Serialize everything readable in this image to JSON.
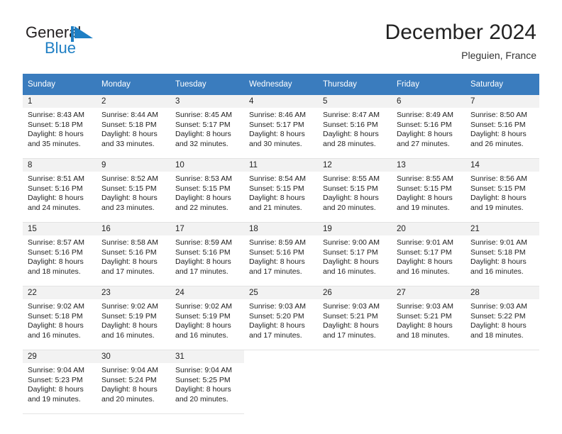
{
  "brand": {
    "name_part1": "General",
    "name_part2": "Blue",
    "flag_icon": "blue-triangle-flag-icon",
    "color_dark": "#231f20",
    "color_blue": "#1f7fc4"
  },
  "header": {
    "month_title": "December 2024",
    "location": "Pleguien, France"
  },
  "calendar": {
    "header_bg": "#3a7cbe",
    "daynum_bg": "#f2f2f2",
    "weekdays": [
      "Sunday",
      "Monday",
      "Tuesday",
      "Wednesday",
      "Thursday",
      "Friday",
      "Saturday"
    ],
    "weeks": [
      [
        {
          "day": "1",
          "sunrise": "Sunrise: 8:43 AM",
          "sunset": "Sunset: 5:18 PM",
          "daylight_line1": "Daylight: 8 hours",
          "daylight_line2": "and 35 minutes."
        },
        {
          "day": "2",
          "sunrise": "Sunrise: 8:44 AM",
          "sunset": "Sunset: 5:18 PM",
          "daylight_line1": "Daylight: 8 hours",
          "daylight_line2": "and 33 minutes."
        },
        {
          "day": "3",
          "sunrise": "Sunrise: 8:45 AM",
          "sunset": "Sunset: 5:17 PM",
          "daylight_line1": "Daylight: 8 hours",
          "daylight_line2": "and 32 minutes."
        },
        {
          "day": "4",
          "sunrise": "Sunrise: 8:46 AM",
          "sunset": "Sunset: 5:17 PM",
          "daylight_line1": "Daylight: 8 hours",
          "daylight_line2": "and 30 minutes."
        },
        {
          "day": "5",
          "sunrise": "Sunrise: 8:47 AM",
          "sunset": "Sunset: 5:16 PM",
          "daylight_line1": "Daylight: 8 hours",
          "daylight_line2": "and 28 minutes."
        },
        {
          "day": "6",
          "sunrise": "Sunrise: 8:49 AM",
          "sunset": "Sunset: 5:16 PM",
          "daylight_line1": "Daylight: 8 hours",
          "daylight_line2": "and 27 minutes."
        },
        {
          "day": "7",
          "sunrise": "Sunrise: 8:50 AM",
          "sunset": "Sunset: 5:16 PM",
          "daylight_line1": "Daylight: 8 hours",
          "daylight_line2": "and 26 minutes."
        }
      ],
      [
        {
          "day": "8",
          "sunrise": "Sunrise: 8:51 AM",
          "sunset": "Sunset: 5:16 PM",
          "daylight_line1": "Daylight: 8 hours",
          "daylight_line2": "and 24 minutes."
        },
        {
          "day": "9",
          "sunrise": "Sunrise: 8:52 AM",
          "sunset": "Sunset: 5:15 PM",
          "daylight_line1": "Daylight: 8 hours",
          "daylight_line2": "and 23 minutes."
        },
        {
          "day": "10",
          "sunrise": "Sunrise: 8:53 AM",
          "sunset": "Sunset: 5:15 PM",
          "daylight_line1": "Daylight: 8 hours",
          "daylight_line2": "and 22 minutes."
        },
        {
          "day": "11",
          "sunrise": "Sunrise: 8:54 AM",
          "sunset": "Sunset: 5:15 PM",
          "daylight_line1": "Daylight: 8 hours",
          "daylight_line2": "and 21 minutes."
        },
        {
          "day": "12",
          "sunrise": "Sunrise: 8:55 AM",
          "sunset": "Sunset: 5:15 PM",
          "daylight_line1": "Daylight: 8 hours",
          "daylight_line2": "and 20 minutes."
        },
        {
          "day": "13",
          "sunrise": "Sunrise: 8:55 AM",
          "sunset": "Sunset: 5:15 PM",
          "daylight_line1": "Daylight: 8 hours",
          "daylight_line2": "and 19 minutes."
        },
        {
          "day": "14",
          "sunrise": "Sunrise: 8:56 AM",
          "sunset": "Sunset: 5:15 PM",
          "daylight_line1": "Daylight: 8 hours",
          "daylight_line2": "and 19 minutes."
        }
      ],
      [
        {
          "day": "15",
          "sunrise": "Sunrise: 8:57 AM",
          "sunset": "Sunset: 5:16 PM",
          "daylight_line1": "Daylight: 8 hours",
          "daylight_line2": "and 18 minutes."
        },
        {
          "day": "16",
          "sunrise": "Sunrise: 8:58 AM",
          "sunset": "Sunset: 5:16 PM",
          "daylight_line1": "Daylight: 8 hours",
          "daylight_line2": "and 17 minutes."
        },
        {
          "day": "17",
          "sunrise": "Sunrise: 8:59 AM",
          "sunset": "Sunset: 5:16 PM",
          "daylight_line1": "Daylight: 8 hours",
          "daylight_line2": "and 17 minutes."
        },
        {
          "day": "18",
          "sunrise": "Sunrise: 8:59 AM",
          "sunset": "Sunset: 5:16 PM",
          "daylight_line1": "Daylight: 8 hours",
          "daylight_line2": "and 17 minutes."
        },
        {
          "day": "19",
          "sunrise": "Sunrise: 9:00 AM",
          "sunset": "Sunset: 5:17 PM",
          "daylight_line1": "Daylight: 8 hours",
          "daylight_line2": "and 16 minutes."
        },
        {
          "day": "20",
          "sunrise": "Sunrise: 9:01 AM",
          "sunset": "Sunset: 5:17 PM",
          "daylight_line1": "Daylight: 8 hours",
          "daylight_line2": "and 16 minutes."
        },
        {
          "day": "21",
          "sunrise": "Sunrise: 9:01 AM",
          "sunset": "Sunset: 5:18 PM",
          "daylight_line1": "Daylight: 8 hours",
          "daylight_line2": "and 16 minutes."
        }
      ],
      [
        {
          "day": "22",
          "sunrise": "Sunrise: 9:02 AM",
          "sunset": "Sunset: 5:18 PM",
          "daylight_line1": "Daylight: 8 hours",
          "daylight_line2": "and 16 minutes."
        },
        {
          "day": "23",
          "sunrise": "Sunrise: 9:02 AM",
          "sunset": "Sunset: 5:19 PM",
          "daylight_line1": "Daylight: 8 hours",
          "daylight_line2": "and 16 minutes."
        },
        {
          "day": "24",
          "sunrise": "Sunrise: 9:02 AM",
          "sunset": "Sunset: 5:19 PM",
          "daylight_line1": "Daylight: 8 hours",
          "daylight_line2": "and 16 minutes."
        },
        {
          "day": "25",
          "sunrise": "Sunrise: 9:03 AM",
          "sunset": "Sunset: 5:20 PM",
          "daylight_line1": "Daylight: 8 hours",
          "daylight_line2": "and 17 minutes."
        },
        {
          "day": "26",
          "sunrise": "Sunrise: 9:03 AM",
          "sunset": "Sunset: 5:21 PM",
          "daylight_line1": "Daylight: 8 hours",
          "daylight_line2": "and 17 minutes."
        },
        {
          "day": "27",
          "sunrise": "Sunrise: 9:03 AM",
          "sunset": "Sunset: 5:21 PM",
          "daylight_line1": "Daylight: 8 hours",
          "daylight_line2": "and 18 minutes."
        },
        {
          "day": "28",
          "sunrise": "Sunrise: 9:03 AM",
          "sunset": "Sunset: 5:22 PM",
          "daylight_line1": "Daylight: 8 hours",
          "daylight_line2": "and 18 minutes."
        }
      ],
      [
        {
          "day": "29",
          "sunrise": "Sunrise: 9:04 AM",
          "sunset": "Sunset: 5:23 PM",
          "daylight_line1": "Daylight: 8 hours",
          "daylight_line2": "and 19 minutes."
        },
        {
          "day": "30",
          "sunrise": "Sunrise: 9:04 AM",
          "sunset": "Sunset: 5:24 PM",
          "daylight_line1": "Daylight: 8 hours",
          "daylight_line2": "and 20 minutes."
        },
        {
          "day": "31",
          "sunrise": "Sunrise: 9:04 AM",
          "sunset": "Sunset: 5:25 PM",
          "daylight_line1": "Daylight: 8 hours",
          "daylight_line2": "and 20 minutes."
        },
        {
          "day": "",
          "sunrise": "",
          "sunset": "",
          "daylight_line1": "",
          "daylight_line2": ""
        },
        {
          "day": "",
          "sunrise": "",
          "sunset": "",
          "daylight_line1": "",
          "daylight_line2": ""
        },
        {
          "day": "",
          "sunrise": "",
          "sunset": "",
          "daylight_line1": "",
          "daylight_line2": ""
        },
        {
          "day": "",
          "sunrise": "",
          "sunset": "",
          "daylight_line1": "",
          "daylight_line2": ""
        }
      ]
    ]
  }
}
